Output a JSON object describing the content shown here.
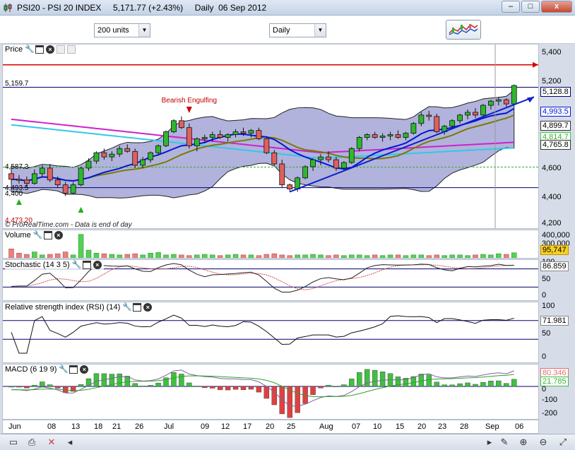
{
  "window": {
    "title": "PSI20 - PSI 20 INDEX     5,171.77 (+2.43%)     Daily  06 Sep 2012",
    "minimize": "–",
    "maximize": "□",
    "close": "x"
  },
  "toolbar": {
    "units_value": "200 units",
    "period_value": "Daily",
    "indicators_icon": "indicators-chart-icon"
  },
  "colors": {
    "up_candle": "#2db82d",
    "down_candle": "#e0605e",
    "bollinger_fill": "#b1b3dc",
    "ma20": "#0018d8",
    "ma50": "#7a7a00",
    "ma100": "#cc22cc",
    "ma200": "#33c8e8",
    "support_line": "#000070",
    "resistance_line": "#d80000",
    "trendline": "#1020c8"
  },
  "price_panel": {
    "title": "Price",
    "y_ticks": [
      "5,400",
      "5,200",
      "4,600",
      "4,400",
      "4,200"
    ],
    "badges": [
      "5,128.8",
      "4,993.5",
      "4,899.7",
      "4,814.7",
      "4,765.8"
    ],
    "left_labels": [
      "5,159.7",
      "4,587.3",
      "4,493.5",
      "4,473.20",
      "4,400"
    ],
    "annotation": "Bearish Engulfing",
    "watermark": "© ProRealTime.com - Data is end of day",
    "top_line_label": "5,159.7"
  },
  "volume_panel": {
    "title": "Volume",
    "y_ticks": [
      "400,000",
      "300,000"
    ],
    "badge": "95,747"
  },
  "stochastic_panel": {
    "title": "Stochastic (14 3 5)",
    "y_ticks": [
      "100",
      "50",
      "0"
    ],
    "badge": "86.859"
  },
  "rsi_panel": {
    "title": "Relative strength index (RSI) (14)",
    "y_ticks": [
      "100",
      "50",
      "0"
    ],
    "badge": "71.981"
  },
  "macd_panel": {
    "title": "MACD (6 19 9)",
    "y_ticks": [
      "0",
      "-100",
      "-200"
    ],
    "badges": [
      "80.346",
      "21.785"
    ]
  },
  "x_axis": {
    "labels": [
      "Jun",
      "08",
      "13",
      "18",
      "21",
      "26",
      "Jul",
      "09",
      "12",
      "17",
      "20",
      "25",
      "Aug",
      "07",
      "10",
      "15",
      "20",
      "23",
      "28",
      "Sep",
      "06"
    ]
  },
  "chart_data": {
    "type": "candlestick",
    "title": "PSI20 - PSI 20 INDEX",
    "period": "Daily",
    "last_close": 5171.77,
    "change_pct": 2.43,
    "ylim": [
      4200,
      5450
    ],
    "levels": {
      "resistance": 5320,
      "upper_line": 5159.7,
      "support": 4440,
      "dashed_green": 4587.3
    },
    "candles": [
      [
        4540,
        4570,
        4480,
        4500
      ],
      [
        4500,
        4530,
        4470,
        4495
      ],
      [
        4495,
        4520,
        4440,
        4470
      ],
      [
        4470,
        4570,
        4460,
        4540
      ],
      [
        4540,
        4600,
        4520,
        4580
      ],
      [
        4580,
        4610,
        4480,
        4495
      ],
      [
        4495,
        4520,
        4440,
        4460
      ],
      [
        4460,
        4480,
        4380,
        4400
      ],
      [
        4400,
        4480,
        4390,
        4460
      ],
      [
        4460,
        4590,
        4450,
        4580
      ],
      [
        4580,
        4650,
        4560,
        4630
      ],
      [
        4630,
        4700,
        4610,
        4690
      ],
      [
        4690,
        4720,
        4640,
        4660
      ],
      [
        4660,
        4700,
        4630,
        4680
      ],
      [
        4680,
        4740,
        4660,
        4720
      ],
      [
        4720,
        4750,
        4690,
        4700
      ],
      [
        4700,
        4720,
        4580,
        4600
      ],
      [
        4600,
        4660,
        4580,
        4640
      ],
      [
        4640,
        4700,
        4620,
        4690
      ],
      [
        4690,
        4750,
        4670,
        4740
      ],
      [
        4740,
        4850,
        4730,
        4840
      ],
      [
        4840,
        4930,
        4830,
        4920
      ],
      [
        4920,
        4950,
        4860,
        4870
      ],
      [
        4870,
        4900,
        4720,
        4740
      ],
      [
        4740,
        4800,
        4700,
        4790
      ],
      [
        4790,
        4820,
        4760,
        4800
      ],
      [
        4800,
        4840,
        4770,
        4820
      ],
      [
        4820,
        4850,
        4790,
        4800
      ],
      [
        4800,
        4830,
        4770,
        4820
      ],
      [
        4820,
        4860,
        4800,
        4840
      ],
      [
        4840,
        4870,
        4810,
        4830
      ],
      [
        4830,
        4860,
        4800,
        4850
      ],
      [
        4850,
        4870,
        4780,
        4790
      ],
      [
        4790,
        4800,
        4680,
        4690
      ],
      [
        4690,
        4710,
        4600,
        4610
      ],
      [
        4610,
        4640,
        4440,
        4460
      ],
      [
        4460,
        4470,
        4410,
        4430
      ],
      [
        4430,
        4520,
        4410,
        4510
      ],
      [
        4510,
        4600,
        4500,
        4590
      ],
      [
        4590,
        4650,
        4560,
        4640
      ],
      [
        4640,
        4680,
        4600,
        4660
      ],
      [
        4660,
        4700,
        4620,
        4640
      ],
      [
        4640,
        4660,
        4560,
        4580
      ],
      [
        4580,
        4630,
        4560,
        4620
      ],
      [
        4620,
        4730,
        4610,
        4720
      ],
      [
        4720,
        4810,
        4700,
        4800
      ],
      [
        4800,
        4830,
        4780,
        4820
      ],
      [
        4820,
        4840,
        4790,
        4800
      ],
      [
        4800,
        4830,
        4770,
        4810
      ],
      [
        4810,
        4840,
        4780,
        4820
      ],
      [
        4820,
        4850,
        4790,
        4800
      ],
      [
        4800,
        4840,
        4780,
        4830
      ],
      [
        4830,
        4910,
        4820,
        4900
      ],
      [
        4900,
        4980,
        4880,
        4960
      ],
      [
        4960,
        4990,
        4920,
        4950
      ],
      [
        4950,
        4970,
        4830,
        4840
      ],
      [
        4840,
        4890,
        4820,
        4880
      ],
      [
        4880,
        4930,
        4860,
        4920
      ],
      [
        4920,
        4970,
        4900,
        4960
      ],
      [
        4960,
        5000,
        4930,
        4980
      ],
      [
        4980,
        5010,
        4940,
        4960
      ],
      [
        4960,
        5040,
        4950,
        5030
      ],
      [
        5030,
        5070,
        5000,
        5060
      ],
      [
        5060,
        5090,
        5030,
        5070
      ],
      [
        5070,
        5080,
        5020,
        5040
      ],
      [
        5040,
        5180,
        5030,
        5172
      ]
    ],
    "volume": [
      160000,
      90000,
      70000,
      110000,
      60000,
      70000,
      80000,
      110000,
      60000,
      400000,
      140000,
      90000,
      80000,
      70000,
      60000,
      70000,
      80000,
      60000,
      90000,
      100000,
      60000,
      70000,
      60000,
      50000,
      60000,
      70000,
      60000,
      50000,
      60000,
      70000,
      60000,
      60000,
      50000,
      70000,
      80000,
      60000,
      50000,
      60000,
      60000,
      70000,
      60000,
      50000,
      60000,
      50000,
      60000,
      60000,
      50000,
      60000,
      50000,
      60000,
      60000,
      50000,
      60000,
      60000,
      50000,
      60000,
      50000,
      60000,
      60000,
      50000,
      60000,
      70000,
      60000,
      80000,
      70000,
      95747
    ],
    "stochastic_last": 86.859,
    "rsi_last": 71.981,
    "macd_last": 80.346,
    "macd_signal_last": 21.785
  }
}
